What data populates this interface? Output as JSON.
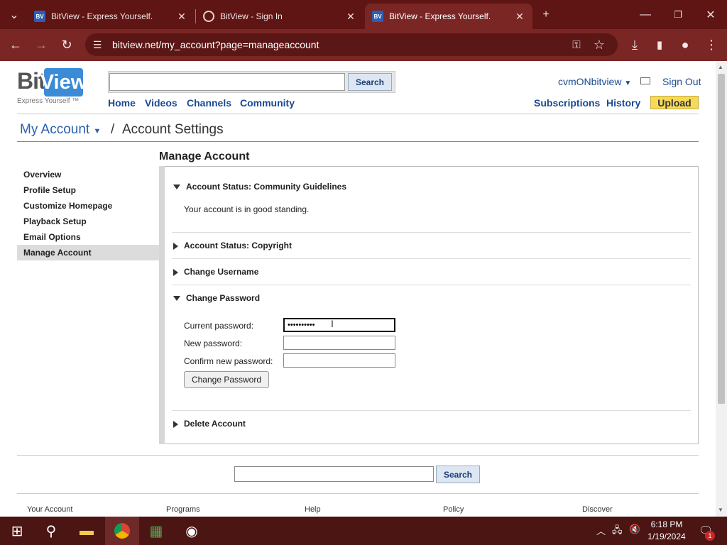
{
  "browser": {
    "tabs": [
      {
        "title": "BitView - Express Yourself.",
        "favicon": "bitview",
        "active": false
      },
      {
        "title": "BitView - Sign In",
        "favicon": "globe",
        "active": false
      },
      {
        "title": "BitView - Express Yourself.",
        "favicon": "bitview",
        "active": true
      }
    ],
    "url": "bitview.net/my_account?page=manageaccount"
  },
  "header": {
    "logo_bit": "Bit",
    "logo_view": "View",
    "logo_tagline": "Express Yourself ™",
    "search_button": "Search",
    "nav": [
      "Home",
      "Videos",
      "Channels",
      "Community"
    ],
    "username": "cvmONbitview",
    "sign_out": "Sign Out",
    "right_nav": [
      "Subscriptions",
      "History"
    ],
    "upload": "Upload"
  },
  "breadcrumb": {
    "root": "My Account",
    "separator": "/",
    "current": "Account Settings"
  },
  "page_title": "Manage Account",
  "sidebar": {
    "items": [
      {
        "label": "Overview",
        "active": false
      },
      {
        "label": "Profile Setup",
        "active": false
      },
      {
        "label": "Customize Homepage",
        "active": false
      },
      {
        "label": "Playback Setup",
        "active": false
      },
      {
        "label": "Email Options",
        "active": false
      },
      {
        "label": "Manage Account",
        "active": true
      }
    ]
  },
  "sections": {
    "community": {
      "title": "Account Status: Community Guidelines",
      "expanded": true,
      "body": "Your account is in good standing."
    },
    "copyright": {
      "title": "Account Status: Copyright",
      "expanded": false
    },
    "username": {
      "title": "Change Username",
      "expanded": false
    },
    "password": {
      "title": "Change Password",
      "expanded": true,
      "current_label": "Current password:",
      "current_value": "••••••••••",
      "new_label": "New password:",
      "confirm_label": "Confirm new password:",
      "button": "Change Password"
    },
    "delete": {
      "title": "Delete Account",
      "expanded": false
    }
  },
  "footer": {
    "search_button": "Search",
    "links": [
      "Your Account",
      "Programs",
      "Help",
      "Policy",
      "Discover"
    ]
  },
  "taskbar": {
    "time": "6:18 PM",
    "date": "1/19/2024",
    "notification_count": "1"
  },
  "colors": {
    "browser_frame": "#5e1514",
    "toolbar": "#7a2624",
    "link": "#1a4a91",
    "upload": "#f4d95a"
  }
}
